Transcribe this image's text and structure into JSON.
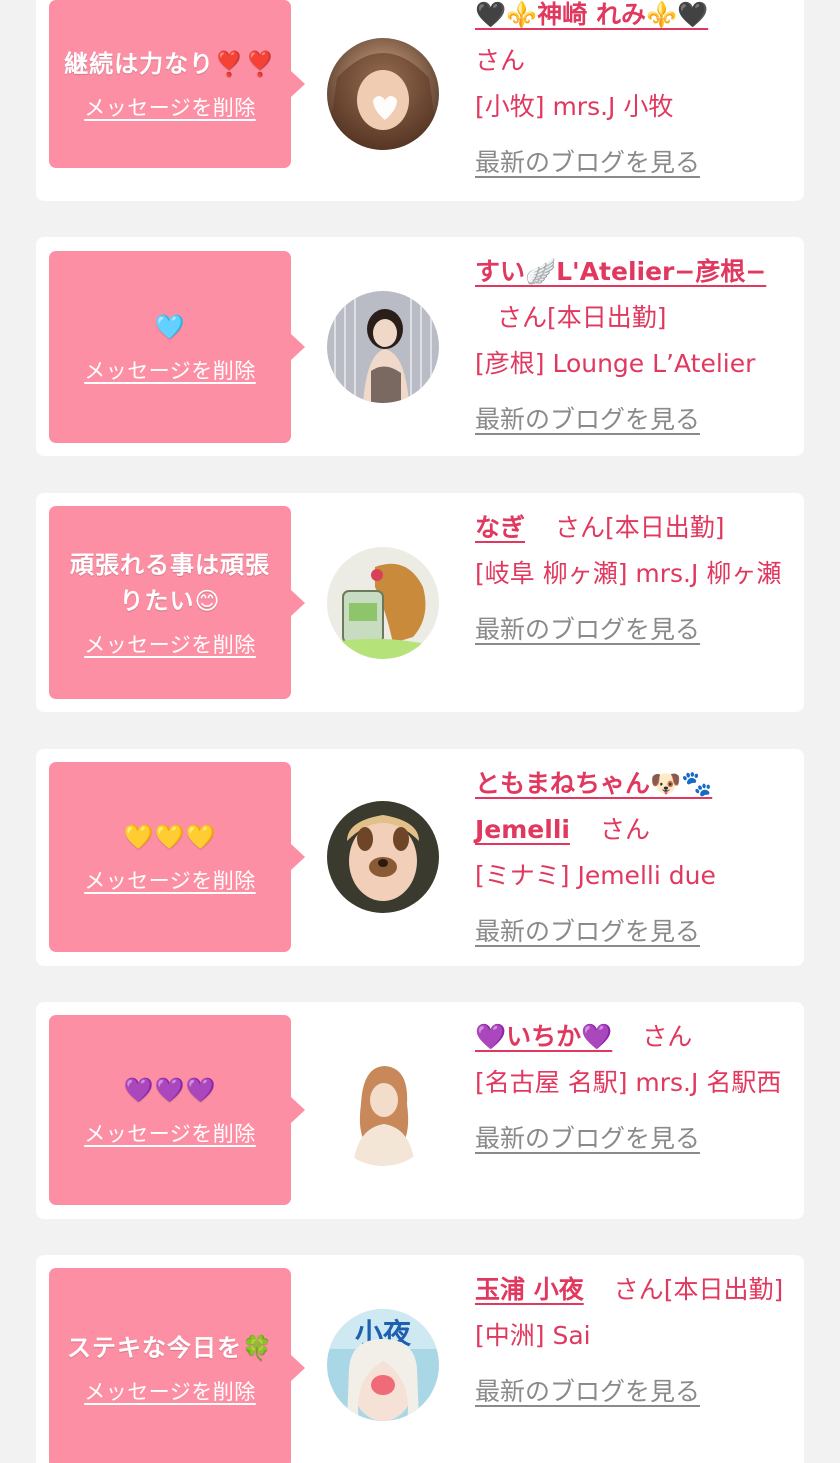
{
  "delete_label": "メッセージを削除",
  "blog_label": "最新のブログを見る",
  "colors": {
    "bubble": "#fd8fa4",
    "accent": "#e0385e",
    "muted": "#8a8a8a",
    "page_bg": "#f2f2f2"
  },
  "items": [
    {
      "message": "継続は力なり❣️❣️",
      "name": "🖤⚜️神崎 れみ⚜️🖤",
      "honorific": "さん",
      "status": "",
      "shop": "[小牧] mrs.J 小牧"
    },
    {
      "message": "🩵",
      "name": "すい🪽L'Atelier−彦根−",
      "honorific": "さん",
      "status": "[本日出勤]",
      "shop": "[彦根] Lounge L’Atelier"
    },
    {
      "message": "頑張れる事は頑張りたい😊",
      "name": "なぎ",
      "honorific": "さん",
      "status": "[本日出勤]",
      "shop": "[岐阜 柳ヶ瀬] mrs.J 柳ヶ瀬"
    },
    {
      "message": "💛💛💛",
      "name": "ともまねちゃん🐶🐾Jemelli",
      "honorific": "さん",
      "status": "",
      "shop": "[ミナミ] Jemelli due"
    },
    {
      "message": "💜💜💜",
      "name": "💜いちか💜",
      "honorific": "さん",
      "status": "",
      "shop": "[名古屋 名駅] mrs.J 名駅西"
    },
    {
      "message": "ステキな今日を🍀",
      "name": "玉浦 小夜",
      "honorific": "さん",
      "status": "[本日出勤]",
      "shop": "[中洲] Sai"
    }
  ]
}
